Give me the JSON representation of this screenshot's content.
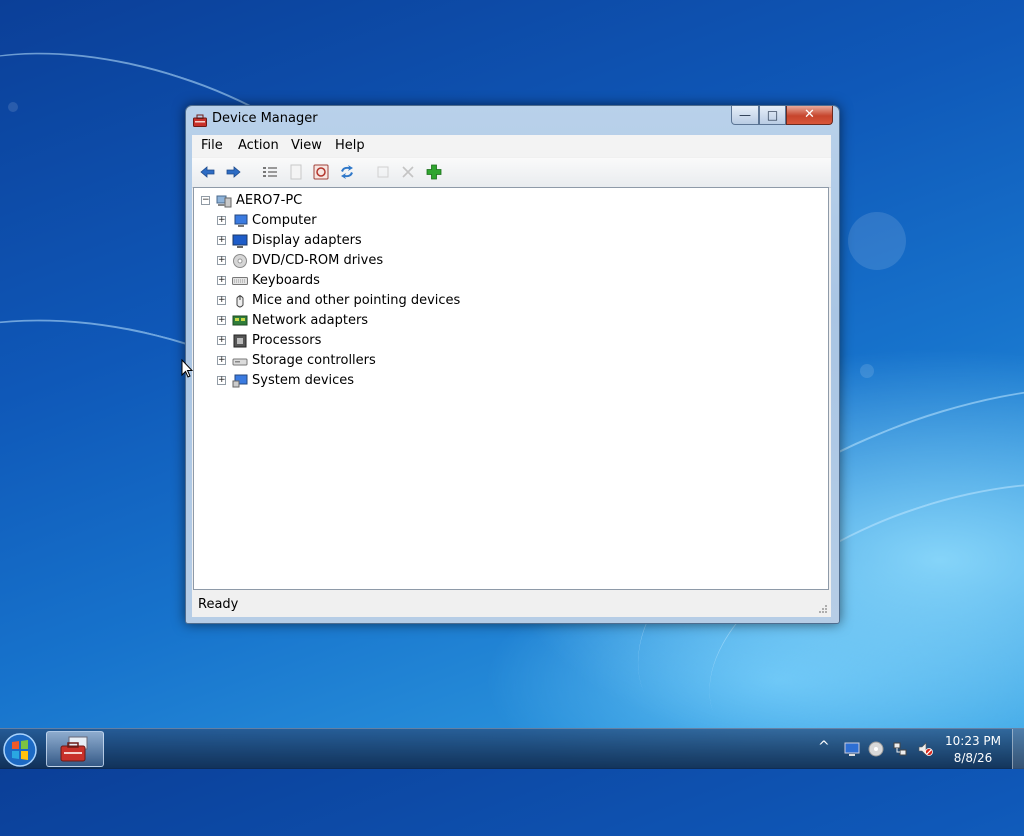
{
  "window": {
    "title": "Device Manager",
    "controls": {
      "minimize": "—",
      "maximize": "□",
      "close": "✕"
    }
  },
  "menu": [
    "File",
    "Action",
    "View",
    "Help"
  ],
  "toolbar": {
    "buttons": [
      "back-icon",
      "forward-icon",
      "properties-list-icon",
      "help-page-icon",
      "scan-hardware-icon",
      "update-driver-icon",
      "disable-device-icon",
      "uninstall-device-icon",
      "add-legacy-hardware-icon"
    ]
  },
  "tree": {
    "root": "AERO7-PC",
    "root_expander": "−",
    "items": [
      {
        "label": "Computer",
        "icon": "computer-icon",
        "expander": "+"
      },
      {
        "label": "Display adapters",
        "icon": "display-adapter-icon",
        "expander": "+"
      },
      {
        "label": "DVD/CD-ROM drives",
        "icon": "dvd-drive-icon",
        "expander": "+"
      },
      {
        "label": "Keyboards",
        "icon": "keyboard-icon",
        "expander": "+"
      },
      {
        "label": "Mice and other pointing devices",
        "icon": "mouse-icon",
        "expander": "+"
      },
      {
        "label": "Network adapters",
        "icon": "network-adapter-icon",
        "expander": "+"
      },
      {
        "label": "Processors",
        "icon": "processor-icon",
        "expander": "+"
      },
      {
        "label": "Storage controllers",
        "icon": "storage-controller-icon",
        "expander": "+"
      },
      {
        "label": "System devices",
        "icon": "system-devices-icon",
        "expander": "+"
      }
    ]
  },
  "status": {
    "text": "Ready"
  },
  "taskbar": {
    "start_icon": "start-orb-icon",
    "task_button_icon": "device-manager-icon",
    "tray": [
      "show-hidden-icons-icon",
      "monitor-icon",
      "cd-icon",
      "network-icon",
      "volume-muted-icon"
    ],
    "tray_arrow": "^",
    "clock": {
      "time": "10:23 PM",
      "date": "8/8/26"
    }
  },
  "colors": {
    "close_button": "#c6452c",
    "window_frame": "#a9c5e4",
    "add_icon": "#2fa52f"
  }
}
